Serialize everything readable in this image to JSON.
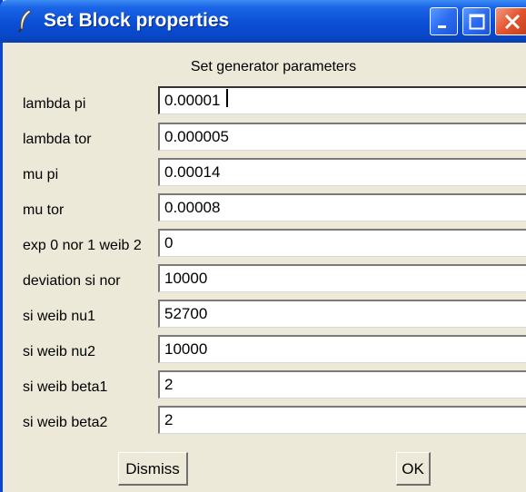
{
  "window": {
    "title": "Set Block properties"
  },
  "dialog": {
    "heading": "Set generator parameters",
    "rows": [
      {
        "label": "lambda pi",
        "value": "0.00001"
      },
      {
        "label": "lambda tor",
        "value": "0.000005"
      },
      {
        "label": "mu pi",
        "value": "0.00014"
      },
      {
        "label": "mu tor",
        "value": "0.00008"
      },
      {
        "label": "exp 0 nor 1 weib 2",
        "value": "0"
      },
      {
        "label": "deviation si nor",
        "value": "10000"
      },
      {
        "label": "si weib nu1",
        "value": "52700"
      },
      {
        "label": "si weib nu2",
        "value": "10000"
      },
      {
        "label": "si weib beta1",
        "value": "2"
      },
      {
        "label": "si weib beta2",
        "value": "2"
      }
    ],
    "dismiss_label": "Dismiss",
    "ok_label": "OK"
  },
  "colors": {
    "titlebar": "#0a4fd6",
    "dialog_bg": "#ece9d8",
    "close_button": "#e2552e"
  },
  "icons": {
    "app": "feather-icon",
    "minimize": "minimize-icon",
    "maximize": "maximize-icon",
    "close": "close-icon"
  }
}
